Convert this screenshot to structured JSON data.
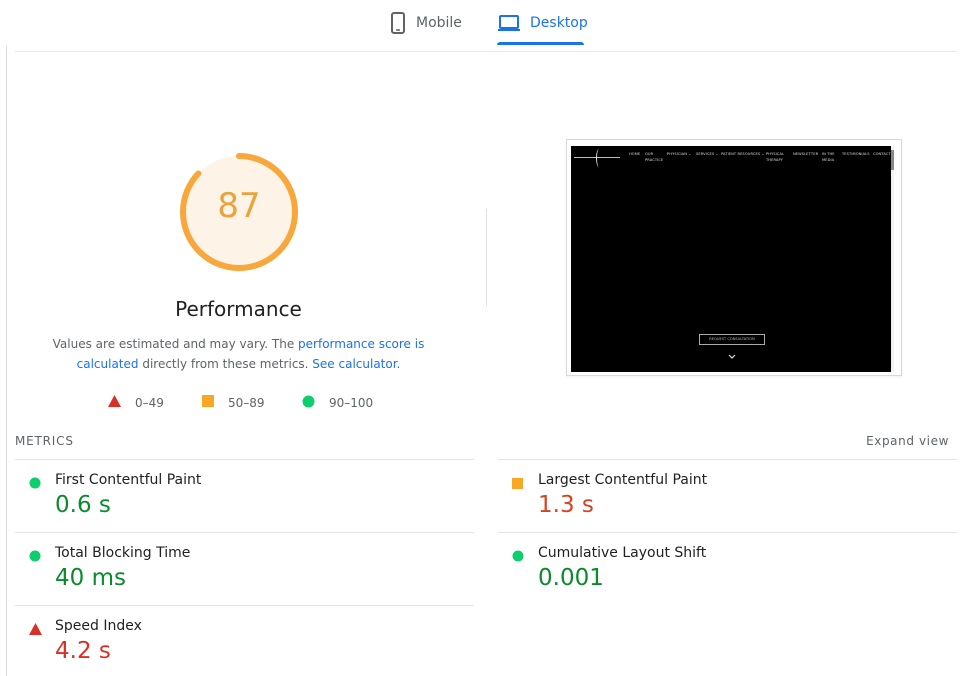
{
  "tabs": [
    {
      "label": "Mobile",
      "icon": "phone-icon",
      "active": false
    },
    {
      "label": "Desktop",
      "icon": "laptop-icon",
      "active": true
    }
  ],
  "performance": {
    "score": "87",
    "score_value": 87,
    "title": "Performance",
    "desc_prefix": "Values are estimated and may vary. The ",
    "desc_link1": "performance score is calculated",
    "desc_middle": " directly from these metrics. ",
    "desc_link2": "See calculator."
  },
  "legend": [
    {
      "range": "0–49",
      "shape": "triangle",
      "color": "#d93025"
    },
    {
      "range": "50–89",
      "shape": "square",
      "color": "#f9a825"
    },
    {
      "range": "90–100",
      "shape": "circle",
      "color": "#0cce6b"
    }
  ],
  "screenshot": {
    "nav_items": [
      "HOME",
      "OUR\nPRACTICE",
      "PHYSICIAN ⌄",
      "SERVICES ⌄",
      "PATIENT RESOURCES ⌄",
      "PHYSICAL\nTHERAPY",
      "NEWSLETTER",
      "IN THE\nMEDIA",
      "TESTIMONIALS",
      "CONTACT"
    ],
    "button_label": "REQUEST CONSULTATION"
  },
  "metrics": {
    "label": "METRICS",
    "expand_label": "Expand view",
    "items": [
      {
        "title": "First Contentful Paint",
        "value": "0.6 s",
        "status": "pass"
      },
      {
        "title": "Largest Contentful Paint",
        "value": "1.3 s",
        "status": "average"
      },
      {
        "title": "Total Blocking Time",
        "value": "40 ms",
        "status": "pass"
      },
      {
        "title": "Cumulative Layout Shift",
        "value": "0.001",
        "status": "pass"
      },
      {
        "title": "Speed Index",
        "value": "4.2 s",
        "status": "fail"
      }
    ]
  },
  "colors": {
    "accent": "#1a73e8",
    "average": "#f9a825",
    "average_text": "#e8a33d",
    "pass": "#0cce6b",
    "fail": "#d93025"
  }
}
